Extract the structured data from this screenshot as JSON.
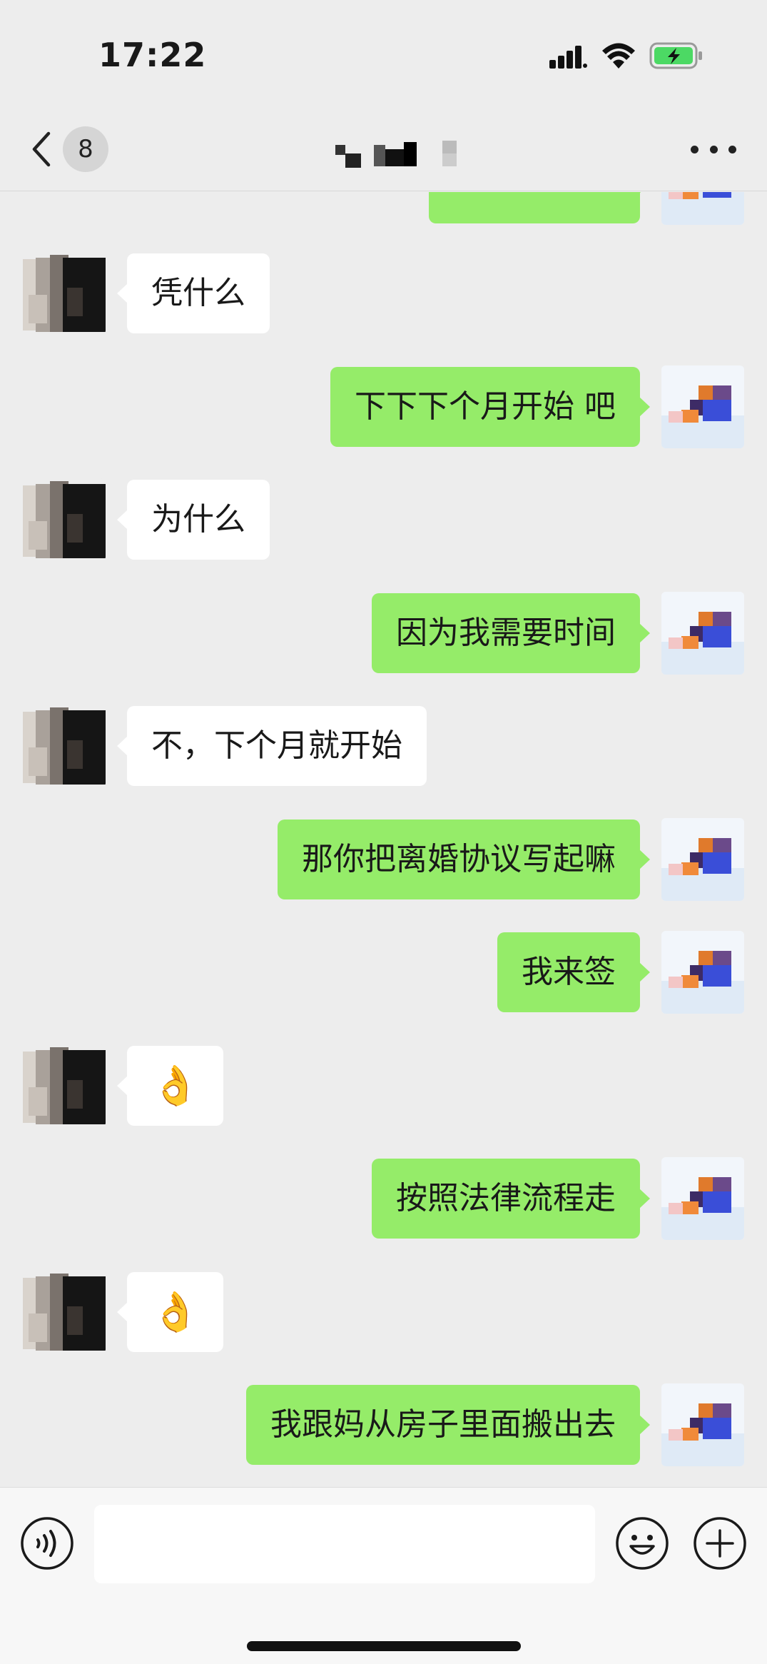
{
  "status_bar": {
    "time": "17:22"
  },
  "nav": {
    "unread_count": "8",
    "title": ""
  },
  "messages": [
    {
      "side": "right",
      "text": ""
    },
    {
      "side": "left",
      "text": "凭什么"
    },
    {
      "side": "right",
      "text": "下下下个月开始 吧"
    },
    {
      "side": "left",
      "text": "为什么"
    },
    {
      "side": "right",
      "text": "因为我需要时间"
    },
    {
      "side": "left",
      "text": "不，下个月就开始"
    },
    {
      "side": "right",
      "text": "那你把离婚协议写起嘛"
    },
    {
      "side": "right",
      "text": "我来签"
    },
    {
      "side": "left",
      "text": "👌"
    },
    {
      "side": "right",
      "text": "按照法律流程走"
    },
    {
      "side": "left",
      "text": "👌"
    },
    {
      "side": "right",
      "text": "我跟妈从房子里面搬出去"
    }
  ],
  "input": {
    "value": "",
    "placeholder": ""
  },
  "colors": {
    "sent_bubble": "#95ec69",
    "received_bubble": "#ffffff",
    "background": "#ededed",
    "battery": "#4cd964"
  },
  "icons": {
    "back": "chevron-left-icon",
    "more": "more-dots-icon",
    "voice": "voice-icon",
    "emoji": "emoji-icon",
    "plus": "plus-icon"
  }
}
